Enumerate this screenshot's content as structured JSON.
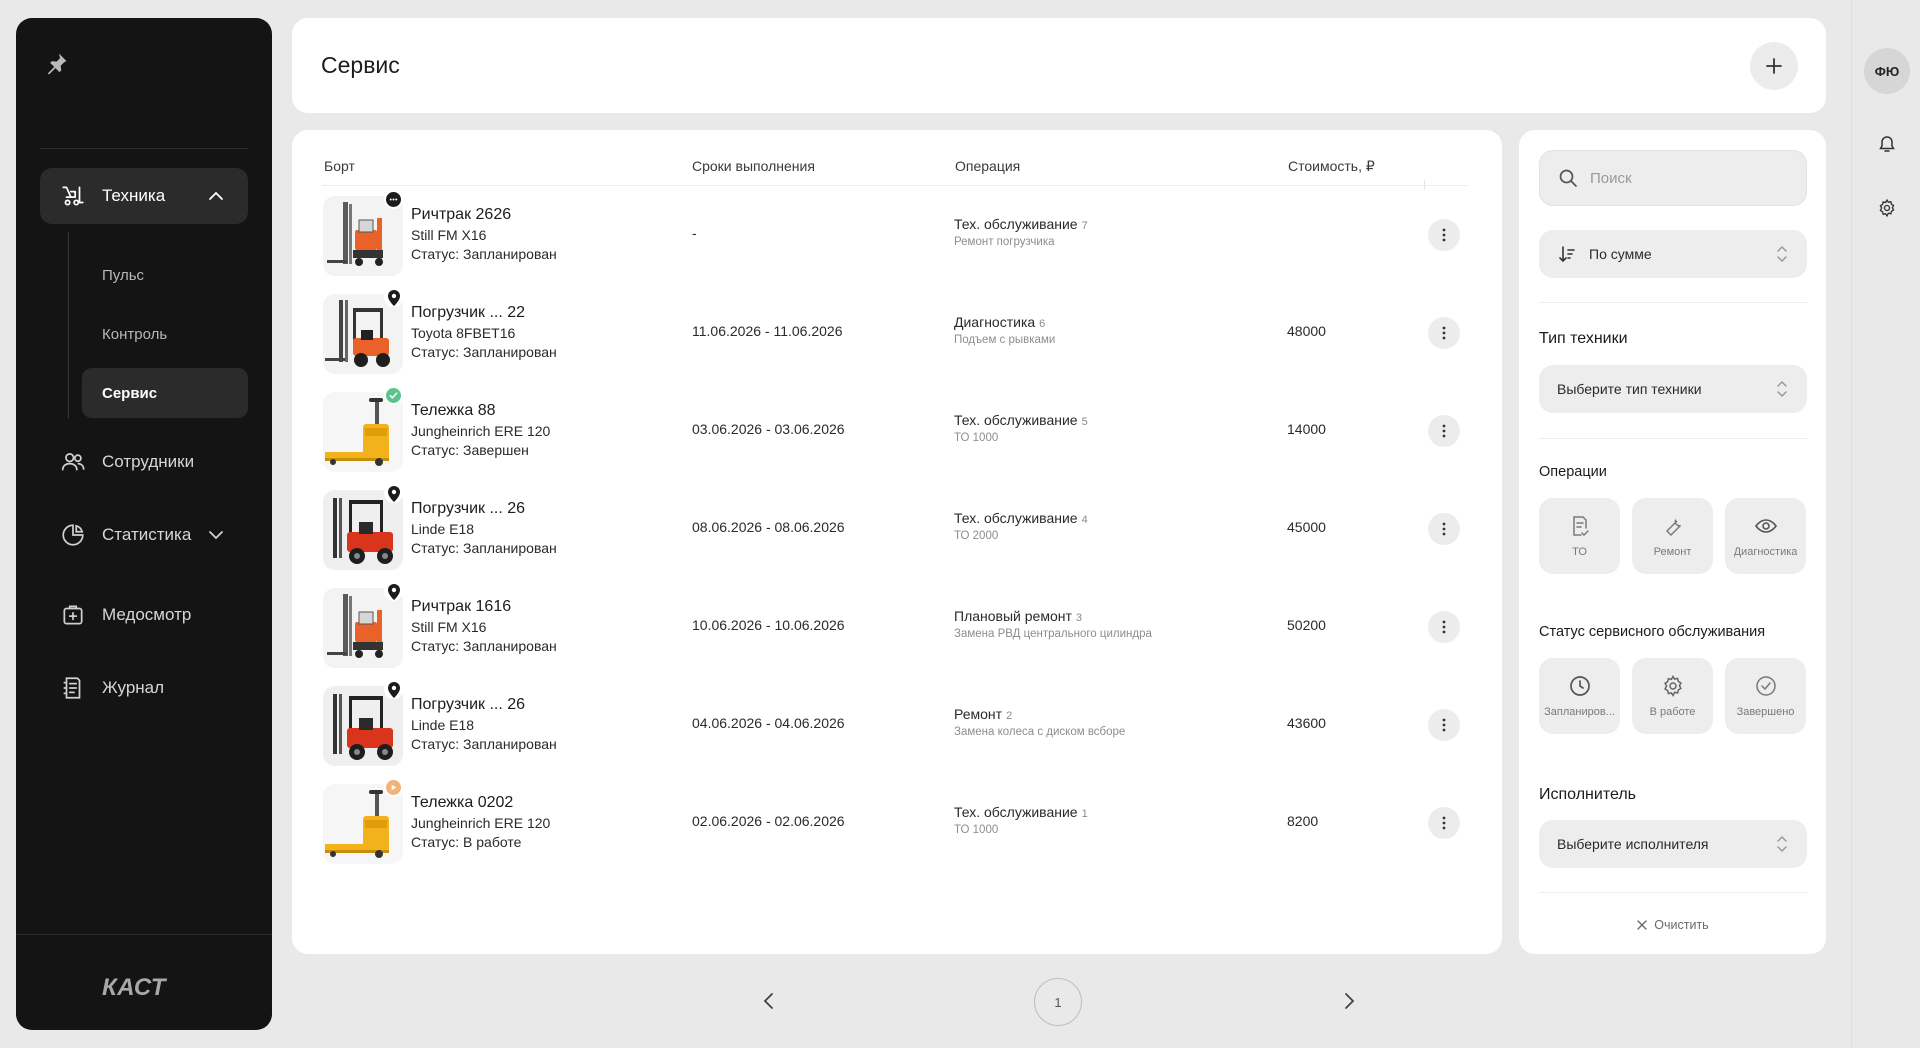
{
  "sidebar": {
    "nav": {
      "tehnika": "Техника",
      "pulse": "Пульс",
      "control": "Контроль",
      "service": "Сервис",
      "employees": "Сотрудники",
      "statistics": "Статистика",
      "medical": "Медосмотр",
      "journal": "Журнал"
    },
    "logo": "КАСТ"
  },
  "header": {
    "title": "Сервис"
  },
  "table": {
    "columns": [
      "Борт",
      "Сроки выполнения",
      "Операция",
      "Стоимость, ₽"
    ],
    "rows": [
      {
        "name": "Ричтрак 2626",
        "model": "Still FM X16",
        "status": "Статус: Запланирован",
        "dates": "-",
        "operation": "Тех. обслуживание",
        "op_count": "7",
        "op_sub": "Ремонт погрузчика",
        "cost": "",
        "badge": "chat",
        "img": "reach"
      },
      {
        "name": "Погрузчик ... 22",
        "model": "Toyota 8FBET16",
        "status": "Статус: Запланирован",
        "dates": "11.06.2026 - 11.06.2026",
        "operation": "Диагностика",
        "op_count": "6",
        "op_sub": "Подъем с рывками",
        "cost": "48000",
        "badge": "pin",
        "img": "forklift"
      },
      {
        "name": "Тележка 88",
        "model": "Jungheinrich ERE 120",
        "status": "Статус: Завершен",
        "dates": "03.06.2026 - 03.06.2026",
        "operation": "Тех. обслуживание",
        "op_count": "5",
        "op_sub": "ТО 1000",
        "cost": "14000",
        "badge": "done",
        "img": "pallet"
      },
      {
        "name": "Погрузчик ... 26",
        "model": "Linde E18",
        "status": "Статус: Запланирован",
        "dates": "08.06.2026 - 08.06.2026",
        "operation": "Тех. обслуживание",
        "op_count": "4",
        "op_sub": "ТО 2000",
        "cost": "45000",
        "badge": "pin",
        "img": "forklift-red"
      },
      {
        "name": "Ричтрак 1616",
        "model": "Still FM X16",
        "status": "Статус: Запланирован",
        "dates": "10.06.2026 - 10.06.2026",
        "operation": "Плановый ремонт",
        "op_count": "3",
        "op_sub": "Замена РВД центрального цилиндра",
        "cost": "50200",
        "badge": "pin",
        "img": "reach"
      },
      {
        "name": "Погрузчик ... 26",
        "model": "Linde E18",
        "status": "Статус: Запланирован",
        "dates": "04.06.2026 - 04.06.2026",
        "operation": "Ремонт",
        "op_count": "2",
        "op_sub": "Замена колеса с диском всборе",
        "cost": "43600",
        "badge": "pin",
        "img": "forklift-red"
      },
      {
        "name": "Тележка 0202",
        "model": "Jungheinrich ERE 120",
        "status": "Статус: В работе",
        "dates": "02.06.2026 - 02.06.2026",
        "operation": "Тех. обслуживание",
        "op_count": "1",
        "op_sub": "ТО 1000",
        "cost": "8200",
        "badge": "play",
        "img": "pallet"
      }
    ]
  },
  "pagination": {
    "current": "1"
  },
  "filters": {
    "search_placeholder": "Поиск",
    "sort_label": "По сумме",
    "type_label": "Тип техники",
    "type_placeholder": "Выберите тип техники",
    "operations_label": "Операции",
    "operations": [
      "ТО",
      "Ремонт",
      "Диагностика"
    ],
    "status_label": "Статус сервисного обслуживания",
    "statuses": [
      "Запланиров...",
      "В работе",
      "Завершено"
    ],
    "executor_label": "Исполнитель",
    "executor_placeholder": "Выберите исполнителя",
    "clear_label": "Очистить"
  },
  "user": {
    "initials": "ФЮ"
  },
  "colors": {
    "sidebar_bg": "#141414",
    "accent_green": "#5cc38f",
    "accent_orange": "#f3b27a",
    "forklift_orange": "#e8622a",
    "pallet_yellow": "#f2b21c"
  }
}
